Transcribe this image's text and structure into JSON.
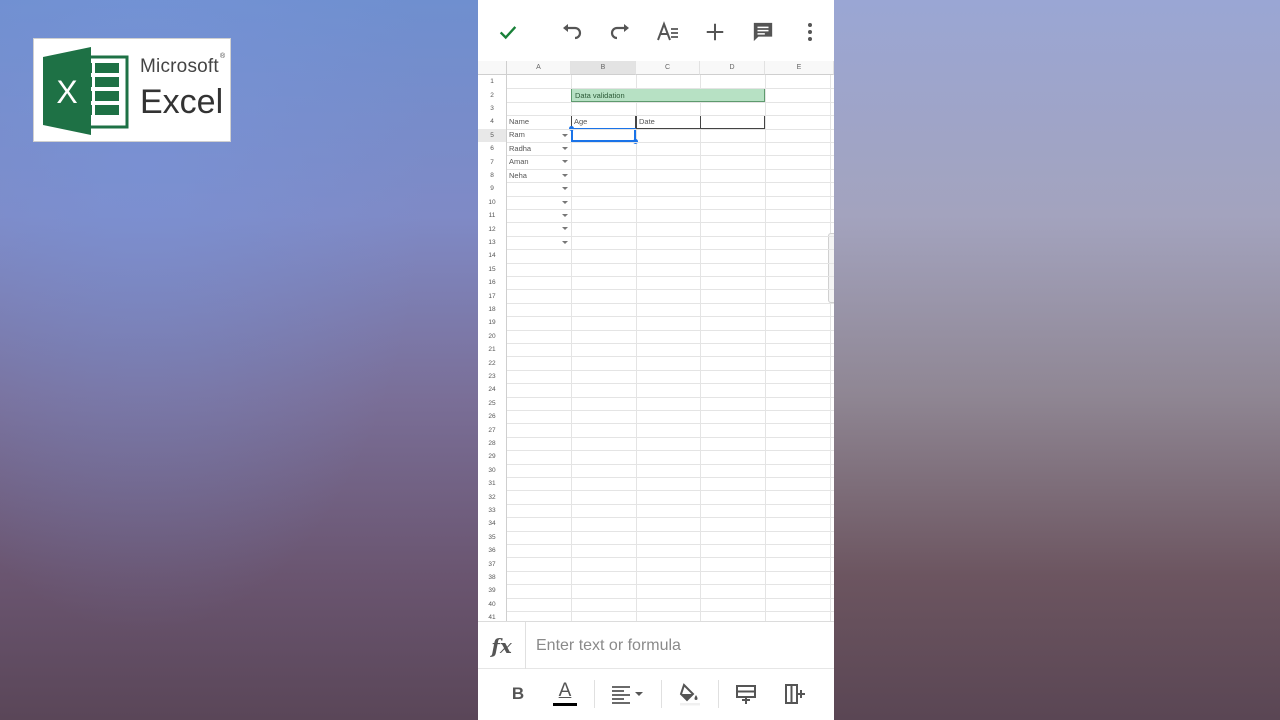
{
  "logo": {
    "brand": "Microsoft",
    "registered": "®",
    "product": "Excel",
    "mark_letter": "X",
    "color": "#1e7145"
  },
  "toolbar": {
    "icons": [
      "check-icon",
      "undo-icon",
      "redo-icon",
      "text-format-icon",
      "insert-icon",
      "comment-icon",
      "more-icon"
    ],
    "accent": "#188038"
  },
  "sheet": {
    "columns": [
      "A",
      "B",
      "C",
      "D",
      "E"
    ],
    "selected_column": "B",
    "rows": [
      "1",
      "2",
      "3",
      "4",
      "5",
      "6",
      "7",
      "8",
      "9",
      "10",
      "11",
      "12",
      "13",
      "14",
      "15",
      "16",
      "17",
      "18",
      "19",
      "20",
      "21",
      "22",
      "23",
      "24",
      "25",
      "26",
      "27",
      "28",
      "29",
      "30",
      "31",
      "32",
      "33",
      "34",
      "35",
      "36",
      "37",
      "38",
      "39",
      "40",
      "41"
    ],
    "selected_row": "5",
    "header_title": "Data validation",
    "headers": {
      "name": "Name",
      "age": "Age",
      "date": "Date"
    },
    "names": [
      "Ram",
      "Radha",
      "Aman",
      "Neha"
    ],
    "dropdown_rows": 9,
    "selection_color": "#1a73e8",
    "highlight_color": "#b7e1c4"
  },
  "formula": {
    "fx_label": "fx",
    "placeholder": "Enter text or formula",
    "value": ""
  },
  "bottom_toolbar": {
    "bold_label": "B",
    "text_color_label": "A",
    "icons": [
      "bold-icon",
      "text-color-icon",
      "align-icon",
      "fill-color-icon",
      "insert-row-icon",
      "insert-column-icon"
    ]
  }
}
